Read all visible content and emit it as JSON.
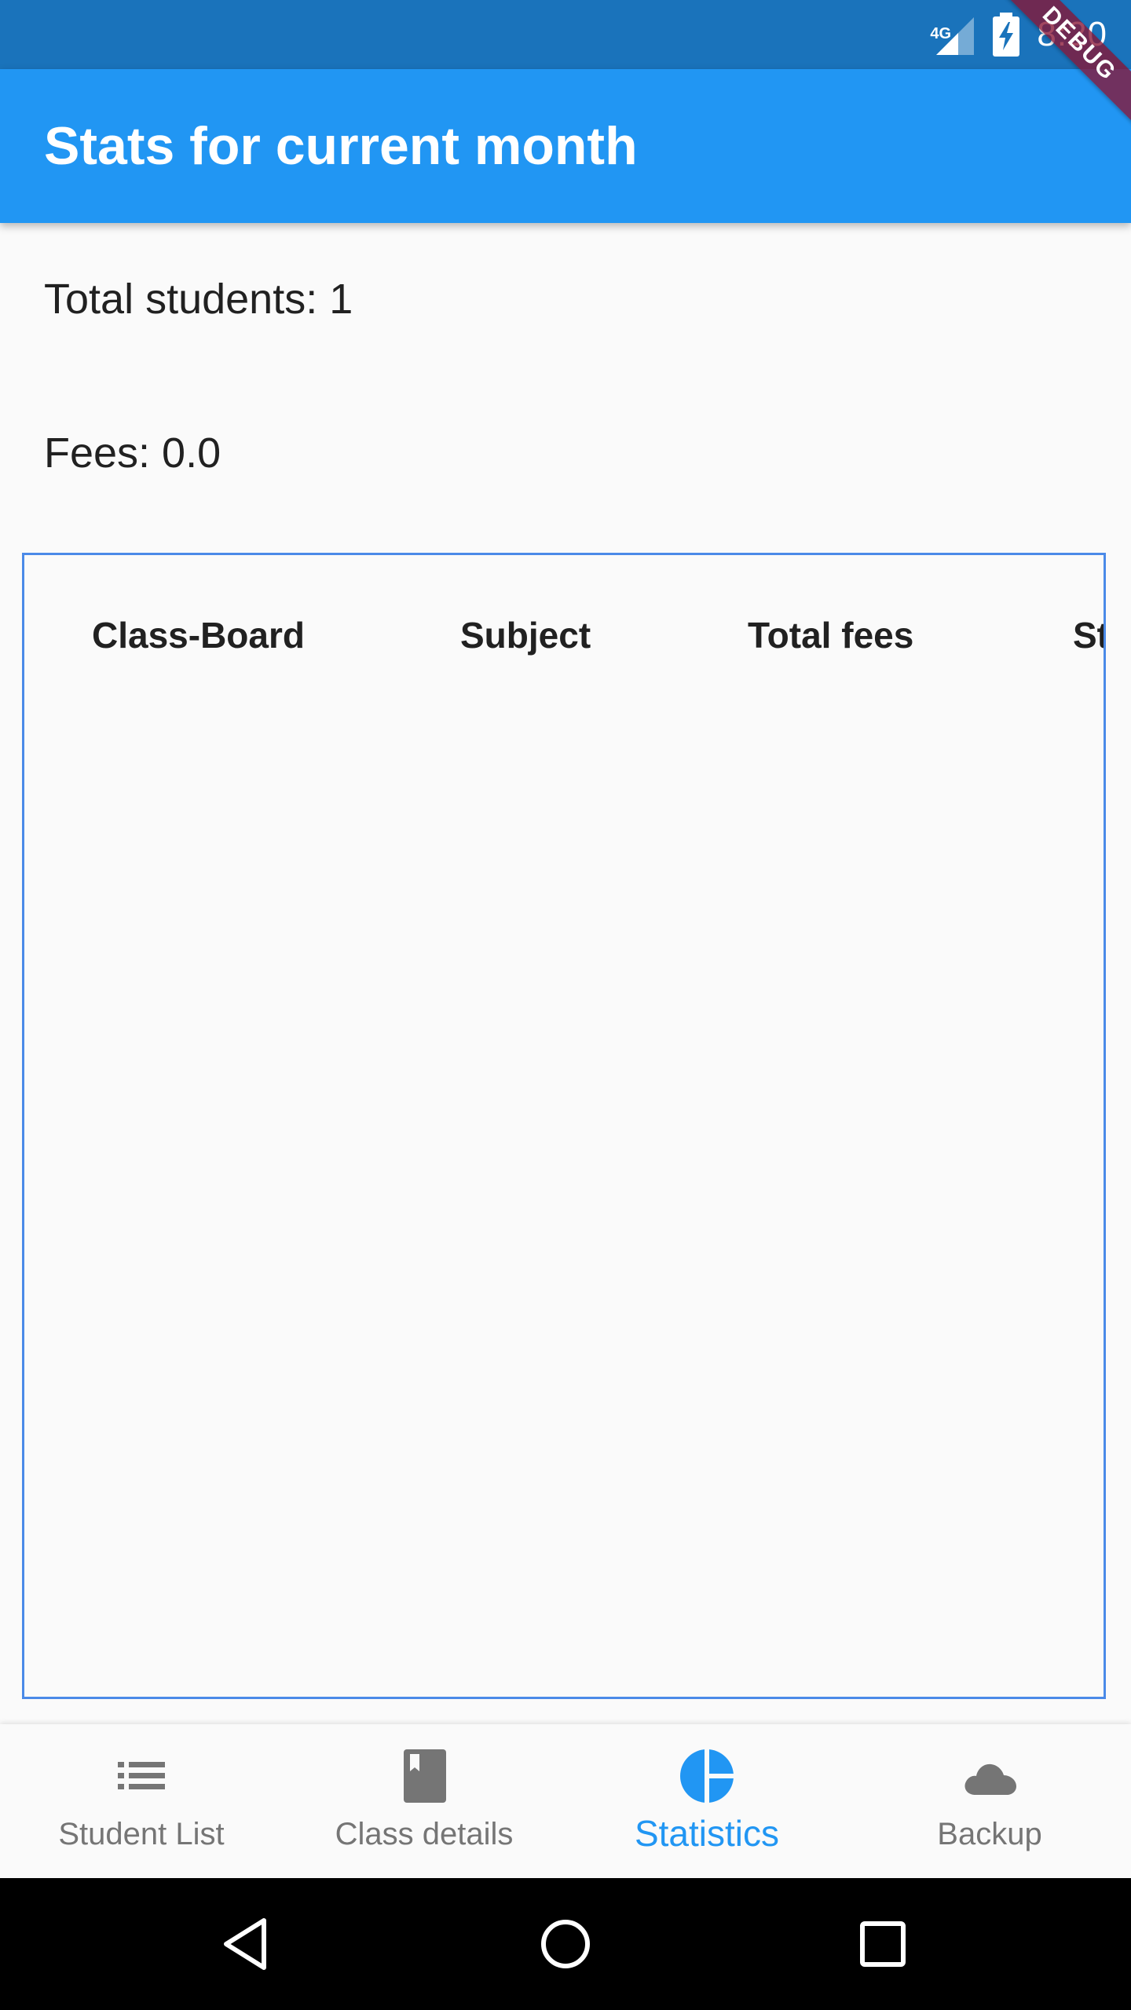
{
  "status_bar": {
    "network": "4G",
    "time": "8:20"
  },
  "debug_banner": "DEBUG",
  "app_bar": {
    "title": "Stats for current month"
  },
  "stats": {
    "total_students": "Total students: 1",
    "fees": "Fees: 0.0"
  },
  "table": {
    "columns": [
      "Class-Board",
      "Subject",
      "Total fees",
      "St"
    ],
    "rows": []
  },
  "bottom_nav": {
    "active_index": 2,
    "accent_color": "#2196f3",
    "items": [
      {
        "label": "Student List",
        "icon": "list-icon"
      },
      {
        "label": "Class details",
        "icon": "book-icon"
      },
      {
        "label": "Statistics",
        "icon": "pie-chart-icon"
      },
      {
        "label": "Backup",
        "icon": "cloud-icon"
      }
    ]
  },
  "system_nav": {
    "buttons": [
      "back-icon",
      "home-icon",
      "recents-icon"
    ]
  }
}
